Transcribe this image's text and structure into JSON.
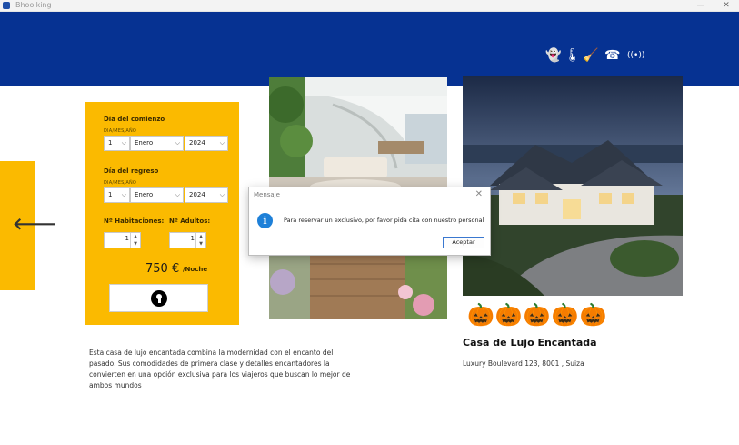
{
  "window": {
    "title": "Bhoolking",
    "minimize": "—",
    "close": "✕"
  },
  "amenities": [
    {
      "icon": "ghost-icon",
      "glyph": "👻"
    },
    {
      "icon": "thermometer-icon",
      "glyph": "🌡"
    },
    {
      "icon": "broom-icon",
      "glyph": "🧹"
    },
    {
      "icon": "phone-icon",
      "glyph": "☎"
    },
    {
      "icon": "wifi-icon",
      "glyph": "((•))"
    }
  ],
  "nav": {
    "back_glyph": "🡐"
  },
  "form": {
    "start_label": "Día del comienzo",
    "start_format": "DIA/MES/AÑO",
    "start_day": "1",
    "start_month": "Enero",
    "start_year": "2024",
    "return_label": "Día del regreso",
    "return_format": "DIA/MES/AÑO",
    "return_day": "1",
    "return_month": "Enero",
    "return_year": "2024",
    "rooms_label": "Nº Habitaciones:",
    "rooms_value": "1",
    "adults_label": "Nº Adultos:",
    "adults_value": "1",
    "price": "750 €",
    "per_night": "/Noche",
    "spin_up": "▲",
    "spin_down": "▼",
    "chevron": "⌵"
  },
  "property": {
    "description": "Esta casa de lujo encantada combina la modernidad con el encanto del pasado. Sus comodidades de primera clase y detalles encantadores la convierten en una opción exclusiva para los viajeros que buscan lo mejor de ambos mundos",
    "name": "Casa de Lujo Encantada",
    "address": "Luxury Boulevard 123, 8001 , Suiza",
    "rating": 5,
    "rating_glyphs": "🎃🎃🎃🎃🎃"
  },
  "dialog": {
    "title": "Mensaje",
    "close": "✕",
    "info_glyph": "i",
    "message": "Para reservar un exclusivo, por favor pida cita con nuestro personal",
    "ok_label": "Aceptar"
  },
  "colors": {
    "banner": "#063292",
    "accent": "#fbba00",
    "info": "#1e80d8"
  }
}
